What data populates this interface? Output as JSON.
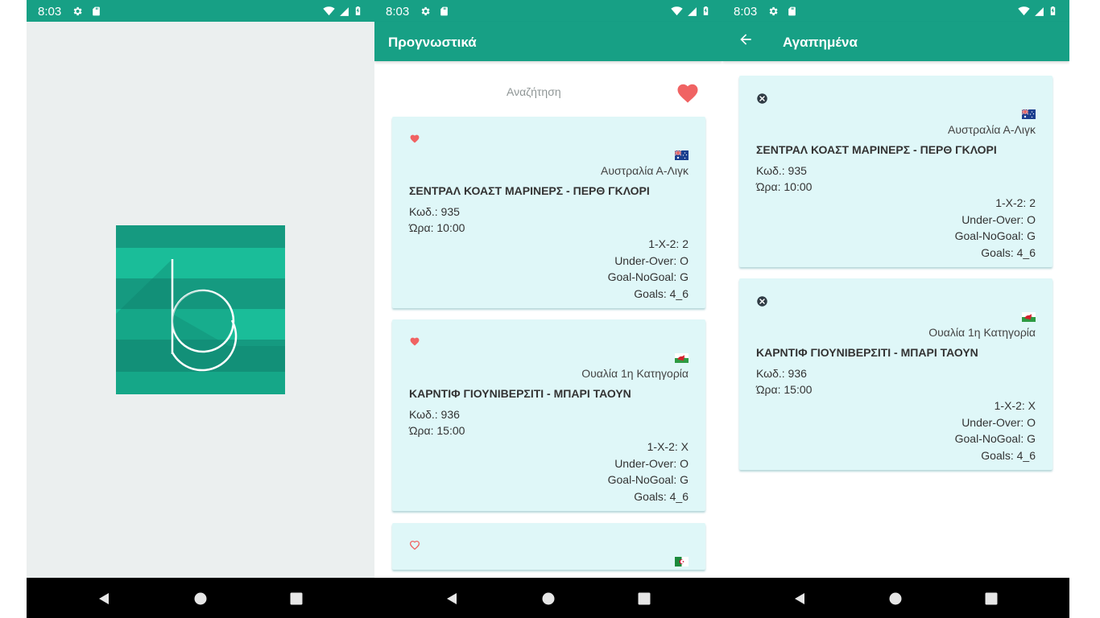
{
  "status": {
    "time": "8:03"
  },
  "colors": {
    "primary": "#17a085",
    "card_bg": "#dff7f8",
    "heart": "#f06363"
  },
  "icons": {
    "status": [
      "gear-icon",
      "sd-card-icon",
      "wifi-icon",
      "cell-signal-icon",
      "battery-icon"
    ],
    "nav": [
      "back-triangle-icon",
      "home-circle-icon",
      "recents-square-icon"
    ]
  },
  "predictions": {
    "title": "Προγνωστικά",
    "search_placeholder": "Αναζήτηση",
    "matches": [
      {
        "favorite": true,
        "flag": "australia",
        "league": "Αυστραλία Α-Λιγκ",
        "match": "ΣΕΝΤΡΑΛ ΚΟΑΣΤ ΜΑΡΙΝΕΡΣ - ΠΕΡΘ ΓΚΛΟΡΙ",
        "code": "Κωδ.: 935",
        "time": "Ώρα: 10:00",
        "tips": [
          "1-Χ-2: 2",
          "Under-Over: O",
          "Goal-NoGoal: G",
          "Goals: 4_6"
        ]
      },
      {
        "favorite": true,
        "flag": "wales",
        "league": "Ουαλία 1η Κατηγορία",
        "match": "ΚΑΡΝΤΙΦ ΓΙΟΥΝΙΒΕΡΣΙΤΙ - ΜΠΑΡΙ ΤΑΟΥΝ",
        "code": "Κωδ.: 936",
        "time": "Ώρα: 15:00",
        "tips": [
          "1-Χ-2: X",
          "Under-Over: O",
          "Goal-NoGoal: G",
          "Goals: 4_6"
        ]
      },
      {
        "favorite": false,
        "flag": "algeria"
      }
    ]
  },
  "favorites": {
    "title": "Αγαπημένα",
    "matches": [
      {
        "flag": "australia",
        "league": "Αυστραλία Α-Λιγκ",
        "match": "ΣΕΝΤΡΑΛ ΚΟΑΣΤ ΜΑΡΙΝΕΡΣ - ΠΕΡΘ ΓΚΛΟΡΙ",
        "code": "Κωδ.: 935",
        "time": "Ώρα: 10:00",
        "tips": [
          "1-Χ-2: 2",
          "Under-Over: O",
          "Goal-NoGoal: G",
          "Goals: 4_6"
        ]
      },
      {
        "flag": "wales",
        "league": "Ουαλία 1η Κατηγορία",
        "match": "ΚΑΡΝΤΙΦ ΓΙΟΥΝΙΒΕΡΣΙΤΙ - ΜΠΑΡΙ ΤΑΟΥΝ",
        "code": "Κωδ.: 936",
        "time": "Ώρα: 15:00",
        "tips": [
          "1-Χ-2: X",
          "Under-Over: O",
          "Goal-NoGoal: G",
          "Goals: 4_6"
        ]
      }
    ]
  }
}
